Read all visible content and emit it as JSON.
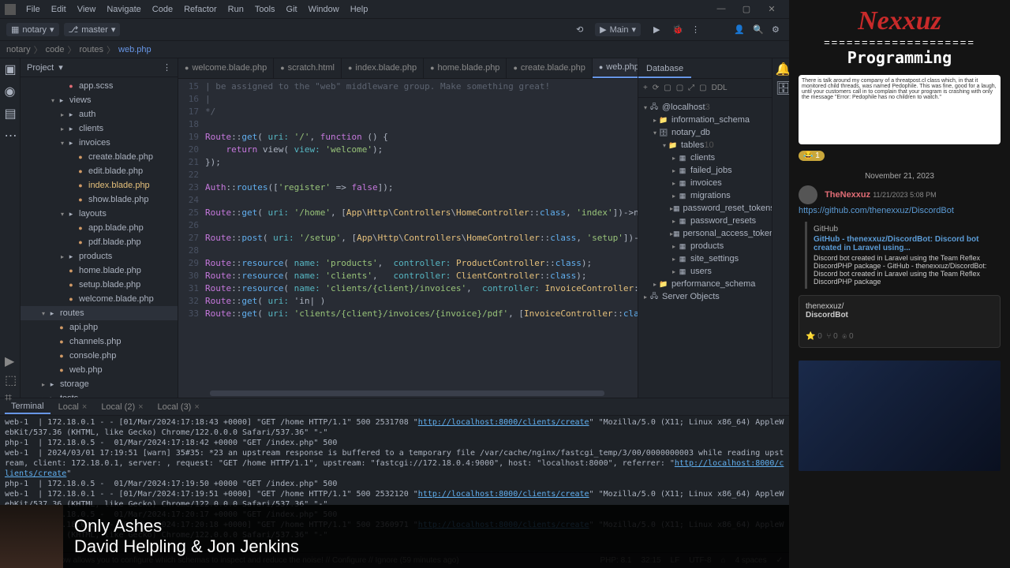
{
  "menubar": [
    "File",
    "Edit",
    "View",
    "Navigate",
    "Code",
    "Refactor",
    "Run",
    "Tools",
    "Git",
    "Window",
    "Help"
  ],
  "project_dropdown": "notary",
  "branch": "master",
  "run_config": "Main",
  "breadcrumbs": [
    "notary",
    "code",
    "routes",
    "web.php"
  ],
  "project_label": "Project",
  "tree": [
    {
      "d": 4,
      "t": "file",
      "c": "css",
      "n": "app.scss"
    },
    {
      "d": 3,
      "t": "folder",
      "open": true,
      "n": "views"
    },
    {
      "d": 4,
      "t": "folder",
      "open": false,
      "n": "auth"
    },
    {
      "d": 4,
      "t": "folder",
      "open": false,
      "n": "clients"
    },
    {
      "d": 4,
      "t": "folder",
      "open": true,
      "n": "invoices"
    },
    {
      "d": 5,
      "t": "file",
      "c": "php",
      "n": "create.blade.php"
    },
    {
      "d": 5,
      "t": "file",
      "c": "php",
      "n": "edit.blade.php"
    },
    {
      "d": 5,
      "t": "file",
      "c": "php",
      "n": "index.blade.php",
      "hl": true
    },
    {
      "d": 5,
      "t": "file",
      "c": "php",
      "n": "show.blade.php"
    },
    {
      "d": 4,
      "t": "folder",
      "open": true,
      "n": "layouts"
    },
    {
      "d": 5,
      "t": "file",
      "c": "php",
      "n": "app.blade.php"
    },
    {
      "d": 5,
      "t": "file",
      "c": "php",
      "n": "pdf.blade.php"
    },
    {
      "d": 4,
      "t": "folder",
      "open": false,
      "n": "products"
    },
    {
      "d": 4,
      "t": "file",
      "c": "php",
      "n": "home.blade.php"
    },
    {
      "d": 4,
      "t": "file",
      "c": "php",
      "n": "setup.blade.php"
    },
    {
      "d": 4,
      "t": "file",
      "c": "php",
      "n": "welcome.blade.php"
    },
    {
      "d": 2,
      "t": "folder",
      "open": true,
      "sel": true,
      "n": "routes"
    },
    {
      "d": 3,
      "t": "file",
      "c": "php",
      "n": "api.php"
    },
    {
      "d": 3,
      "t": "file",
      "c": "php",
      "n": "channels.php"
    },
    {
      "d": 3,
      "t": "file",
      "c": "php",
      "n": "console.php"
    },
    {
      "d": 3,
      "t": "file",
      "c": "php",
      "n": "web.php"
    },
    {
      "d": 2,
      "t": "folder",
      "open": false,
      "n": "storage"
    },
    {
      "d": 2,
      "t": "folder",
      "open": false,
      "n": "tests"
    }
  ],
  "tabs": [
    {
      "icon": "php",
      "label": "welcome.blade.php"
    },
    {
      "icon": "html",
      "label": "scratch.html"
    },
    {
      "icon": "php",
      "label": "index.blade.php"
    },
    {
      "icon": "php",
      "label": "home.blade.php"
    },
    {
      "icon": "php",
      "label": "create.blade.php"
    },
    {
      "icon": "php",
      "label": "web.php",
      "active": true
    }
  ],
  "code_start_line": 15,
  "code_lines": [
    "| be assigned to the \"web\" middleware group. Make something great!",
    "|",
    "*/",
    "",
    "Route::get( uri: '/', function () {",
    "    return view( view: 'welcome');",
    "});",
    "",
    "Auth::routes(['register' => false]);",
    "",
    "Route::get( uri: '/home', [App\\Http\\Controllers\\HomeController::class, 'index'])->name( name: 'home');",
    "",
    "Route::post( uri: '/setup', [App\\Http\\Controllers\\HomeController::class, 'setup'])->name( name: 'setup');",
    "",
    "Route::resource( name: 'products',  controller: ProductController::class);",
    "Route::resource( name: 'clients',   controller: ClientController::class);",
    "Route::resource( name: 'clients/{client}/invoices',  controller: InvoiceController::class)->except(['index']);",
    "Route::get( uri: 'in| )",
    "Route::get( uri: 'clients/{client}/invoices/{invoice}/pdf', [InvoiceController::class, 'pdf'])->name( name: 'invoicesL…"
  ],
  "database_label": "Database",
  "db_toolbar": [
    "+",
    "⟳",
    "▢",
    "▢",
    "⤢",
    "▢",
    "DDL"
  ],
  "db_tree": [
    {
      "d": 0,
      "chev": "▾",
      "ico": "🖧",
      "n": "@localhost",
      "suf": "3"
    },
    {
      "d": 1,
      "chev": "▸",
      "ico": "📁",
      "n": "information_schema"
    },
    {
      "d": 1,
      "chev": "▾",
      "ico": "🗄",
      "n": "notary_db"
    },
    {
      "d": 2,
      "chev": "▾",
      "ico": "📁",
      "n": "tables",
      "suf": "10"
    },
    {
      "d": 3,
      "chev": "▸",
      "ico": "▦",
      "n": "clients"
    },
    {
      "d": 3,
      "chev": "▸",
      "ico": "▦",
      "n": "failed_jobs"
    },
    {
      "d": 3,
      "chev": "▸",
      "ico": "▦",
      "n": "invoices"
    },
    {
      "d": 3,
      "chev": "▸",
      "ico": "▦",
      "n": "migrations"
    },
    {
      "d": 3,
      "chev": "▸",
      "ico": "▦",
      "n": "password_reset_tokens"
    },
    {
      "d": 3,
      "chev": "▸",
      "ico": "▦",
      "n": "password_resets"
    },
    {
      "d": 3,
      "chev": "▸",
      "ico": "▦",
      "n": "personal_access_token"
    },
    {
      "d": 3,
      "chev": "▸",
      "ico": "▦",
      "n": "products"
    },
    {
      "d": 3,
      "chev": "▸",
      "ico": "▦",
      "n": "site_settings"
    },
    {
      "d": 3,
      "chev": "▸",
      "ico": "▦",
      "n": "users"
    },
    {
      "d": 1,
      "chev": "▸",
      "ico": "📁",
      "n": "performance_schema"
    },
    {
      "d": 0,
      "chev": "▸",
      "ico": "🖧",
      "n": "Server Objects"
    }
  ],
  "terminal_tabs": [
    {
      "label": "Terminal",
      "active": true
    },
    {
      "label": "Local",
      "close": true
    },
    {
      "label": "Local (2)",
      "close": true
    },
    {
      "label": "Local (3)",
      "close": true
    }
  ],
  "terminal_lines": [
    {
      "p": "web-1",
      "t": "  | 172.18.0.1 - - [01/Mar/2024:17:18:43 +0000] \"GET /home HTTP/1.1\" 500 2531708 \"",
      "l": "http://localhost:8000/clients/create",
      "r": "\" \"Mozilla/5.0 (X11; Linux x86_64) AppleWebKit/537.36 (KHTML, like Gecko) Chrome/122.0.0.0 Safari/537.36\" \"-\""
    },
    {
      "p": "php-1",
      "t": "  | 172.18.0.5 -  01/Mar/2024:17:18:42 +0000 \"GET /index.php\" 500"
    },
    {
      "p": "web-1",
      "t": "  | 2024/03/01 17:19:51 [warn] 35#35: *23 an upstream response is buffered to a temporary file /var/cache/nginx/fastcgi_temp/3/00/0000000003 while reading upstream, client: 172.18.0.1, server: , request: \"GET /home HTTP/1.1\", upstream: \"fastcgi://172.18.0.4:9000\", host: \"localhost:8000\", referrer: \"",
      "l": "http://localhost:8000/clients/create",
      "r": "\""
    },
    {
      "p": "php-1",
      "t": "  | 172.18.0.5 -  01/Mar/2024:17:19:50 +0000 \"GET /index.php\" 500"
    },
    {
      "p": "web-1",
      "t": "  | 172.18.0.1 - - [01/Mar/2024:17:19:51 +0000] \"GET /home HTTP/1.1\" 500 2532120 \"",
      "l": "http://localhost:8000/clients/create",
      "r": "\" \"Mozilla/5.0 (X11; Linux x86_64) AppleWebKit/537.36 (KHTML, like Gecko) Chrome/122.0.0.0 Safari/537.36\" \"-\""
    },
    {
      "p": "php-1",
      "t": "  | 172.18.0.5 -  01/Mar/2024:17:20:17 +0000 \"GET /index.php\" 500"
    },
    {
      "p": "web-1",
      "t": "  | 172.18.0.1 - - [01/Mar/2024:17:20:18 +0000] \"GET /home HTTP/1.1\" 500 2360971 \"",
      "l": "http://localhost:8000/clients/create",
      "r": "\" \"Mozilla/5.0 (X11; Linux x86_64) AppleWebKit/537.36 (KHTML, like Gecko) Chrome/122.0.0.0 Safari/537.36\" \"-\""
    }
  ],
  "status_tip": "Laravel query now allows you to configure which schemas to inspect and reduce the noise! // Configure // Ignore (59 minutes ago)",
  "status_right": [
    "PHP: 8.1",
    "32:15",
    "LF",
    "UTF-8",
    "⌂",
    "4 spaces",
    "✓"
  ],
  "nowplaying": {
    "title": "Only Ashes",
    "artist": "David Helpling & Jon Jenkins"
  },
  "overlay": {
    "brand": "Nexxuz",
    "sep": "====================",
    "sub": "Programming",
    "badge": "1",
    "date": "November 21, 2023",
    "msg_user": "TheNexxuz",
    "msg_time": "11/21/2023 5:08 PM",
    "msg_link": "https://github.com/thenexxuz/DiscordBot",
    "embed_src": "GitHub",
    "embed_title": "GitHub - thenexxuz/DiscordBot: Discord bot created in Laravel using...",
    "embed_desc": "Discord bot created in Laravel using the Team Reflex DiscordPHP package - GitHub - thenexxuz/DiscordBot: Discord bot created in Laravel using the Team Reflex DiscordPHP package",
    "repo_owner": "thenexxuz/",
    "repo_name": "DiscordBot"
  }
}
